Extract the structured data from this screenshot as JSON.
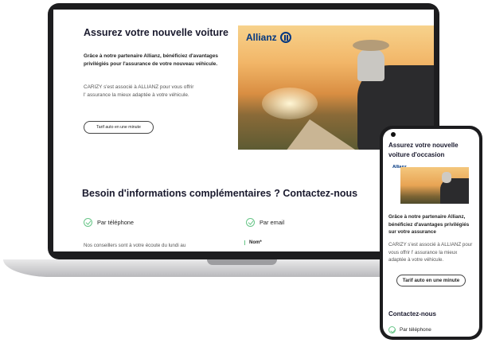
{
  "desktop": {
    "title": "Assurez votre nouvelle voiture",
    "lead": "Grâce à notre partenaire Allianz, bénéficiez d'avantages privilégiés pour l'assurance de votre nouveau véhicule.",
    "body": "CARIZY s'est associé à ALLIANZ pour vous offrir l' assurance la mieux adaptée à votre véhicule.",
    "cta_label": "Tarif auto en une minute",
    "partner_logo": "Allianz",
    "contact_title": "Besoin d'informations complémentaires ? Contactez-nous",
    "phone_label": "Par téléphone",
    "email_label": "Par email",
    "phone_text": "Nos conseillers sont à votre écoute du lundi au",
    "name_field_label": "Nom*"
  },
  "mobile": {
    "title": "Assurez votre nouvelle voiture d'occasion",
    "partner_logo": "Allianz",
    "lead": "Grâce à notre partenaire Allianz, bénéficiez d'avantages privilégiés sur votre assurance",
    "body": "CARIZY s'est associé à ALLIANZ pour vous offrir l' assurance la mieux adaptée à votre véhicule.",
    "cta_label": "Tarif auto en une minute",
    "contact_title": "Contactez-nous",
    "phone_label": "Par téléphone"
  },
  "colors": {
    "allianz_blue": "#003781",
    "check_green": "#67c587",
    "heading": "#1a1a2e"
  },
  "icons": {
    "check": "check-circle-icon",
    "allianz": "allianz-logo"
  }
}
